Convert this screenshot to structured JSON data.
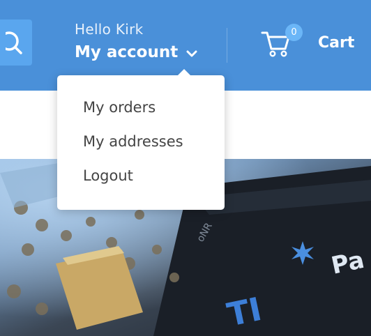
{
  "header": {
    "greeting": "Hello Kirk",
    "account_label": "My account",
    "cart": {
      "count": "0",
      "label": "Cart"
    }
  },
  "account_menu": {
    "items": [
      {
        "label": "My orders"
      },
      {
        "label": "My addresses"
      },
      {
        "label": "Logout"
      }
    ]
  },
  "hero_image": {
    "visible_text": [
      "Pa",
      "TI",
      "oNR"
    ]
  },
  "icons": [
    "search-icon",
    "chevron-down-icon",
    "cart-icon"
  ],
  "colors": {
    "header_bg": "#4a90d9",
    "search_bg": "#5aa6ee",
    "badge_bg": "#6bb6f7",
    "menu_text": "#444444"
  }
}
